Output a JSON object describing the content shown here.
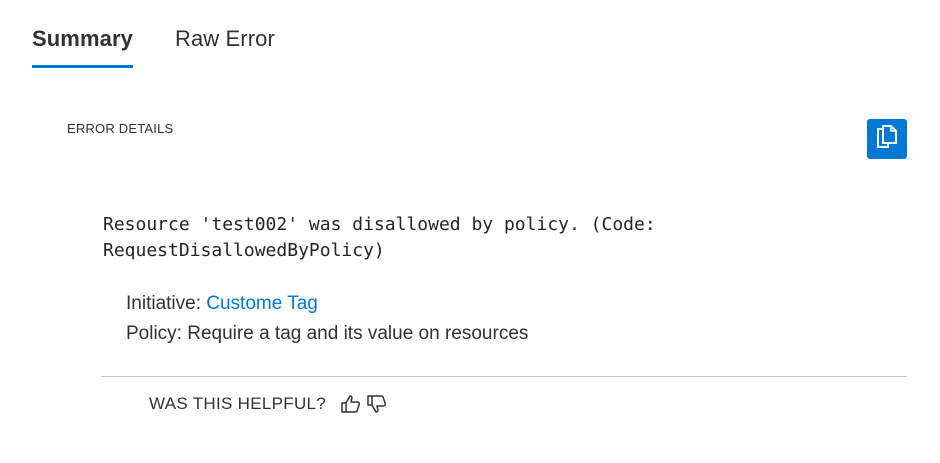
{
  "tabs": [
    {
      "label": "Summary",
      "active": true
    },
    {
      "label": "Raw Error",
      "active": false
    }
  ],
  "error_details": {
    "section_label": "ERROR DETAILS",
    "copy_icon": "copy-icon",
    "message": "Resource 'test002' was disallowed by policy. (Code:\nRequestDisallowedByPolicy)",
    "initiative_label": "Initiative:",
    "initiative_value": "Custome Tag",
    "policy_label": "Policy:",
    "policy_value": "Require a tag and its value on resources"
  },
  "feedback": {
    "label": "WAS THIS HELPFUL?",
    "thumbs_up_icon": "thumbs-up-icon",
    "thumbs_down_icon": "thumbs-down-icon"
  },
  "colors": {
    "accent": "#0078d4",
    "text": "#323130",
    "divider": "#c8c6c4"
  }
}
